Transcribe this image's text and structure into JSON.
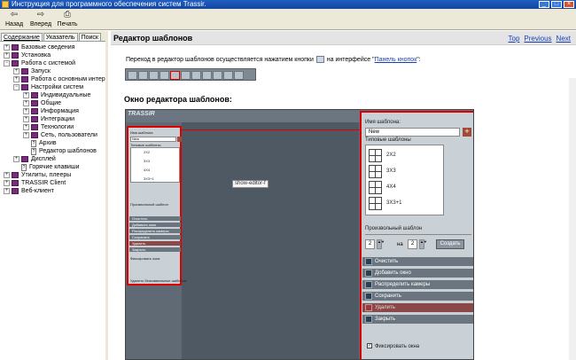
{
  "window": {
    "title": "Инструкция для программного обеспечения систем Trassir."
  },
  "toolbar": {
    "back": "Назад",
    "forward": "Вперед",
    "print": "Печать"
  },
  "tabs": [
    "Содержание",
    "Указатель",
    "Поиск"
  ],
  "tree": [
    {
      "exp": "+",
      "kind": "book",
      "label": "Базовые сведения",
      "level": 0
    },
    {
      "exp": "+",
      "kind": "book",
      "label": "Установка",
      "level": 0
    },
    {
      "exp": "−",
      "kind": "book",
      "label": "Работа с системой",
      "level": 0
    },
    {
      "exp": "+",
      "kind": "book",
      "label": "Запуск",
      "level": 1
    },
    {
      "exp": "+",
      "kind": "book",
      "label": "Работа с основным интерфейсом",
      "level": 1
    },
    {
      "exp": "−",
      "kind": "book",
      "label": "Настройки систем",
      "level": 1
    },
    {
      "exp": "+",
      "kind": "book",
      "label": "Индивидуальные",
      "level": 2
    },
    {
      "exp": "+",
      "kind": "book",
      "label": "Общие",
      "level": 2
    },
    {
      "exp": "+",
      "kind": "book",
      "label": "Информация",
      "level": 2
    },
    {
      "exp": "+",
      "kind": "book",
      "label": "Интеграции",
      "level": 2
    },
    {
      "exp": "+",
      "kind": "book",
      "label": "Технологии",
      "level": 2
    },
    {
      "exp": "+",
      "kind": "book",
      "label": "Сеть, пользователи",
      "level": 2
    },
    {
      "exp": "",
      "kind": "page",
      "label": "Архив",
      "level": 2
    },
    {
      "exp": "",
      "kind": "page",
      "label": "Редактор шаблонов",
      "level": 2
    },
    {
      "exp": "+",
      "kind": "book",
      "label": "Дисплей",
      "level": 1
    },
    {
      "exp": "",
      "kind": "page",
      "label": "Горячие клавиши",
      "level": 1
    },
    {
      "exp": "+",
      "kind": "book",
      "label": "Утилиты, плееры",
      "level": 0
    },
    {
      "exp": "+",
      "kind": "book",
      "label": "TRASSIR Client",
      "level": 0
    },
    {
      "exp": "+",
      "kind": "book",
      "label": "Веб-клиент",
      "level": 0
    }
  ],
  "content": {
    "title": "Редактор шаблонов",
    "nav": {
      "top": "Top",
      "previous": "Previous",
      "next": "Next"
    },
    "intro_before": "Переход в редактор шаблонов осуществляется нажатием кнопки",
    "intro_after": "на интерфейсе \"",
    "intro_link": "Панель кнопок",
    "intro_end": "\":",
    "section_title": "Окно редактора шаблонов:"
  },
  "screenshot": {
    "logo": "TRASSIR",
    "tooltip": "show-editor-f",
    "mini": {
      "name_label": "Имя шаблона",
      "name_value": "New",
      "typical_label": "Типовые шаблоны",
      "items": [
        "2X2",
        "3X3",
        "4X4",
        "3X3+1"
      ],
      "custom_label": "Произвольный шаблон",
      "buttons": [
        "Очистить",
        "Добавить окно",
        "Распределить камеры",
        "Сохранить",
        "Удалить",
        "Закрыть"
      ],
      "fix_label": "Фиксировать окна",
      "footer": "Удалить безсимвольные шаблоны"
    },
    "panel": {
      "name_label": "Имя шаблона:",
      "name_value": "New",
      "add_symbol": "+",
      "typical_label": "Типовые шаблоны",
      "items": [
        "2X2",
        "3X3",
        "4X4",
        "3X3+1"
      ],
      "custom_label": "Произвольный шаблон",
      "spin_a": "2",
      "spin_b": "2",
      "na": "на",
      "create": "Создать",
      "buttons": [
        {
          "label": "Очистить",
          "style": "normal"
        },
        {
          "label": "Добавить окно",
          "style": "normal"
        },
        {
          "label": "Распределить камеры",
          "style": "normal"
        },
        {
          "label": "Сохранить",
          "style": "normal"
        },
        {
          "label": "Удалить",
          "style": "red"
        },
        {
          "label": "Закрыть",
          "style": "normal"
        }
      ],
      "fix_label": "Фиксировать окна"
    }
  }
}
